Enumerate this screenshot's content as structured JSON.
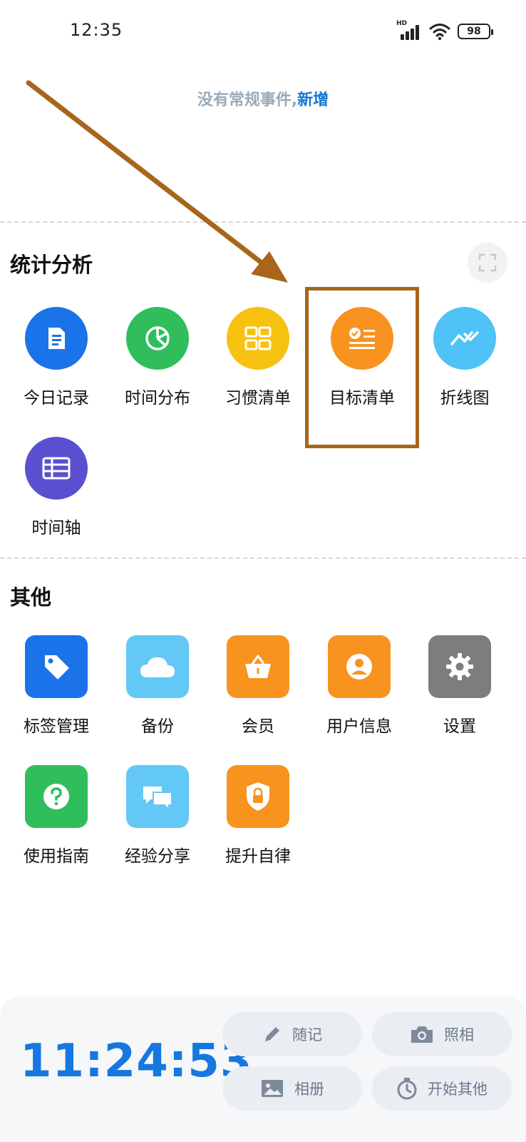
{
  "status_bar": {
    "time": "12:35",
    "network_label": "HD",
    "battery_level": "98",
    "icons": [
      "signal-icon",
      "wifi-icon",
      "battery-icon"
    ]
  },
  "routine_events": {
    "empty_text": "没有常规事件,",
    "add_link": "新增"
  },
  "statistics": {
    "title": "统计分析",
    "expand_icon": "fullscreen-icon",
    "items": [
      {
        "label": "今日记录",
        "icon": "document-icon",
        "color": "#1a73e8"
      },
      {
        "label": "时间分布",
        "icon": "pie-chart-icon",
        "color": "#2fbe5b"
      },
      {
        "label": "习惯清单",
        "icon": "grid-icon",
        "color": "#f7c20f"
      },
      {
        "label": "目标清单",
        "icon": "checklist-icon",
        "color": "#f7931e"
      },
      {
        "label": "折线图",
        "icon": "line-chart-icon",
        "color": "#4fc3f7"
      },
      {
        "label": "时间轴",
        "icon": "table-icon",
        "color": "#5b4fd1"
      }
    ]
  },
  "others": {
    "title": "其他",
    "items": [
      {
        "label": "标签管理",
        "icon": "tag-icon",
        "color": "#1a73e8"
      },
      {
        "label": "备份",
        "icon": "cloud-icon",
        "color": "#63c8f5"
      },
      {
        "label": "会员",
        "icon": "basket-icon",
        "color": "#f7931e"
      },
      {
        "label": "用户信息",
        "icon": "user-icon",
        "color": "#f7931e"
      },
      {
        "label": "设置",
        "icon": "gear-icon",
        "color": "#7d7d7d"
      },
      {
        "label": "使用指南",
        "icon": "help-icon",
        "color": "#2fbe5b"
      },
      {
        "label": "经验分享",
        "icon": "chat-icon",
        "color": "#63c8f5"
      },
      {
        "label": "提升自律",
        "icon": "lock-icon",
        "color": "#f7931e"
      }
    ]
  },
  "bottom_panel": {
    "clock": "11:24:53",
    "actions": [
      {
        "label": "随记",
        "icon": "pencil-icon"
      },
      {
        "label": "照相",
        "icon": "camera-icon"
      },
      {
        "label": "相册",
        "icon": "image-icon"
      },
      {
        "label": "开始其他",
        "icon": "stopwatch-icon"
      }
    ]
  },
  "annotation": {
    "color": "#a8651c"
  }
}
